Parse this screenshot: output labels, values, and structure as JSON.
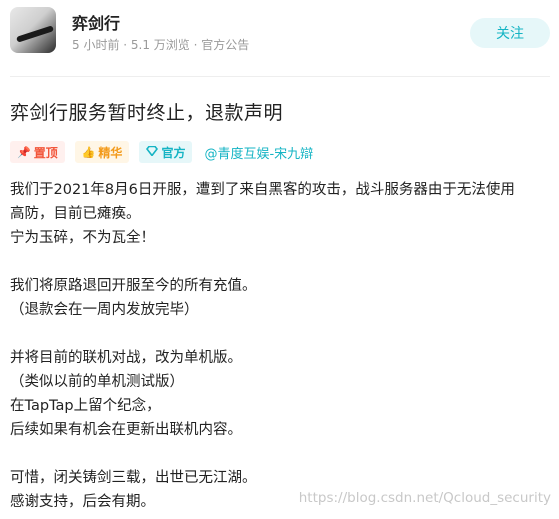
{
  "header": {
    "author_name": "弈剑行",
    "meta": "5 小时前 · 5.1 万浏览 · 官方公告",
    "follow_label": "关注"
  },
  "post": {
    "title": "弈剑行服务暂时终止，退款声明",
    "tags": {
      "top": "置顶",
      "best": "精华",
      "official": "官方"
    },
    "group_link": "@青度互娱-宋九辯",
    "lines": [
      "我们于2021年8月6日开服，遭到了来自黑客的攻击，战斗服务器由于无法使用",
      "高防，目前已瘫痪。",
      "宁为玉碎，不为瓦全！",
      "",
      "我们将原路退回开服至今的所有充值。",
      "（退款会在一周内发放完毕）",
      "",
      "并将目前的联机对战，改为单机版。",
      "（类似以前的单机测试版）",
      "在TapTap上留个纪念，",
      "后续如果有机会在更新出联机内容。",
      "",
      "可惜，闭关铸剑三载，出世已无江湖。",
      "感谢支持，后会有期。"
    ]
  },
  "watermark": "https://blog.csdn.net/Qcloud_security",
  "colors": {
    "accent": "#15b4c4",
    "top_tag": "#f2553a",
    "best_tag": "#f39a1a"
  }
}
